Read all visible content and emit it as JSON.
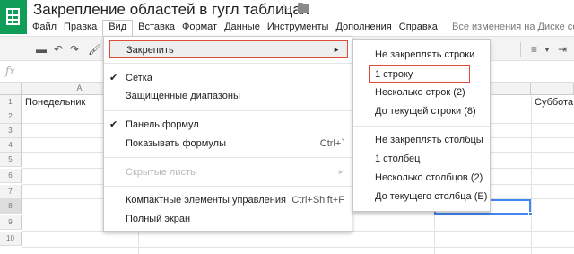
{
  "header": {
    "title": "Закрепление областей в гугл таблицах",
    "save_status": "Все изменения на Диске сох"
  },
  "menubar": {
    "items": [
      "Файл",
      "Правка",
      "Вид",
      "Вставка",
      "Формат",
      "Данные",
      "Инструменты",
      "Дополнения",
      "Справка"
    ],
    "active": "Вид"
  },
  "formula_bar": {
    "fx": "fx"
  },
  "grid": {
    "columns": [
      "A"
    ],
    "rows": [
      "1",
      "2",
      "3",
      "4",
      "5",
      "6",
      "7",
      "8",
      "9",
      "10"
    ],
    "selected_row": "8",
    "cells": {
      "A1": "Понедельник",
      "G1": "Суббота"
    }
  },
  "view_menu": {
    "freeze": {
      "label": "Закрепить"
    },
    "gridlines": {
      "label": "Сетка",
      "checked": true
    },
    "protected_ranges": {
      "label": "Защищенные диапазоны"
    },
    "formula_bar": {
      "label": "Панель формул",
      "checked": true
    },
    "show_formulas": {
      "label": "Показывать формулы",
      "shortcut": "Ctrl+`"
    },
    "hidden_sheets": {
      "label": "Скрытые листы",
      "disabled": true
    },
    "compact_controls": {
      "label": "Компактные элементы управления",
      "shortcut": "Ctrl+Shift+F"
    },
    "full_screen": {
      "label": "Полный экран"
    }
  },
  "freeze_submenu": {
    "items": [
      "Не закреплять строки",
      "1 строку",
      "Несколько строк (2)",
      "До текущей строки (8)",
      "Не закреплять столбцы",
      "1 столбец",
      "Несколько столбцов (2)",
      "До текущего столбца (E)"
    ],
    "highlighted": "1 строку"
  },
  "colors": {
    "brand_green": "#0f9d58",
    "highlight_border": "#dd4b39",
    "selection_blue": "#4285f4"
  }
}
